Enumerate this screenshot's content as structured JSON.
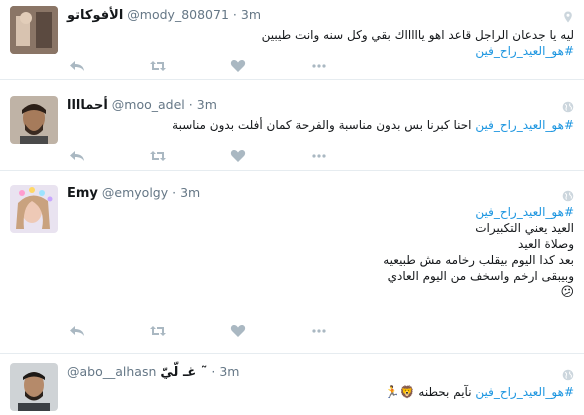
{
  "icons": {
    "reply": "reply-icon",
    "retweet": "retweet-icon",
    "like": "heart-icon",
    "more": "more-dots-icon",
    "geo": "location-pin-icon",
    "globe": "globe-icon"
  },
  "colors": {
    "hashtag": "#1b95e0",
    "action_icon": "#aab8c2",
    "meta": "#657786"
  },
  "hashtag": "#هو_العيد_راح_فين",
  "tweets": [
    {
      "name": "الأفوكاتو",
      "handle": "@mody_808071",
      "time": "3m",
      "text": "ليه يا جدعان الراجل قاعد اهو ياااااك بقي وكل سنه وانت طيبين",
      "hashtag_line": "#هو_العيد_راح_فين"
    },
    {
      "name": "أحماااا",
      "handle": "@moo_adel",
      "time": "3m",
      "text_before": "",
      "text_after": " احنا كبرنا بس بدون مناسبة والفرحة كمان أفلت بدون مناسبة"
    },
    {
      "name": "Emy",
      "handle": "@emyolgy",
      "time": "3m",
      "lines": [
        "العيد يعني التكبيرات",
        "وصلاة العيد",
        "بعد كدا اليوم بيقلب رخامه مش طبيعيه",
        "وبيبقى ارخم واسخف من اليوم العادي"
      ],
      "emoji": "😕"
    },
    {
      "name": "غـ لّيّ ˜",
      "handle": "@abo__alhasn",
      "time": "3m",
      "text_after": " نآيم بحطنه",
      "emoji": "🦁🏃"
    }
  ]
}
